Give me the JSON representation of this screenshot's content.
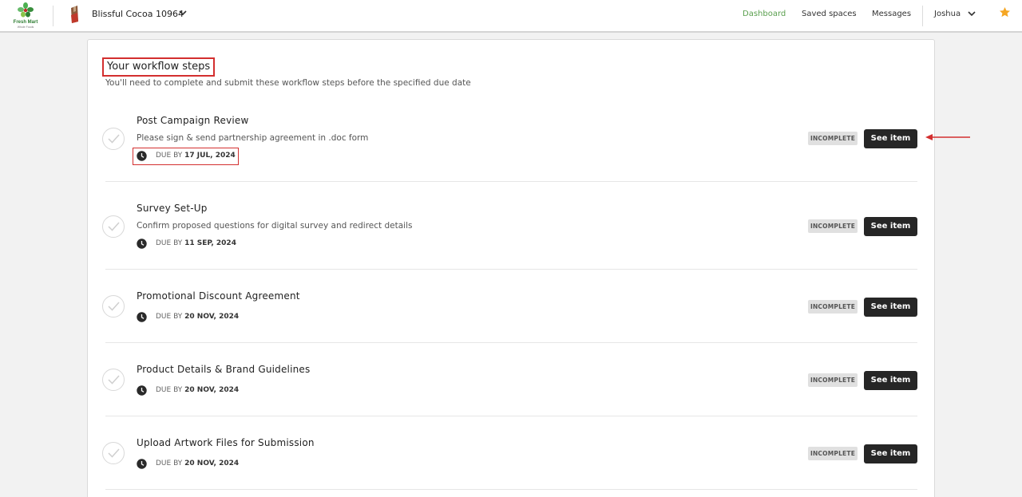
{
  "header": {
    "logo": {
      "name": "Fresh Mart",
      "tagline": "Whole Foods"
    },
    "brand": {
      "name": "Blissful Cocoa 10964"
    },
    "nav": [
      {
        "label": "Dashboard",
        "active": true
      },
      {
        "label": "Saved spaces",
        "active": false
      },
      {
        "label": "Messages",
        "active": false
      }
    ],
    "user": {
      "name": "Joshua"
    },
    "icons": [
      "leaf-logo-icon",
      "chocolate-bar-icon",
      "chevron-down-icon",
      "star-icon"
    ]
  },
  "workflow": {
    "title": "Your workflow steps",
    "subtitle": "You'll need to complete and submit these workflow steps before the specified due date",
    "due_prefix": "DUE BY",
    "steps": [
      {
        "title": "Post Campaign Review",
        "description": "Please sign & send partnership agreement in .doc form",
        "due_date": "17 JUL, 2024",
        "status": "INCOMPLETE",
        "action": "See item"
      },
      {
        "title": "Survey Set-Up",
        "description": "Confirm proposed questions for digital survey and redirect details",
        "due_date": "11 SEP, 2024",
        "status": "INCOMPLETE",
        "action": "See item"
      },
      {
        "title": "Promotional Discount Agreement",
        "description": "",
        "due_date": "20 NOV, 2024",
        "status": "INCOMPLETE",
        "action": "See item"
      },
      {
        "title": "Product Details & Brand Guidelines",
        "description": "",
        "due_date": "20 NOV, 2024",
        "status": "INCOMPLETE",
        "action": "See item"
      },
      {
        "title": "Upload Artwork Files for Submission",
        "description": "",
        "due_date": "20 NOV, 2024",
        "status": "INCOMPLETE",
        "action": "See item"
      }
    ]
  },
  "colors": {
    "accent_green": "#5a9f4e",
    "highlight_red": "#d32f2f",
    "button_dark": "#262626",
    "star_orange": "#f5a623"
  }
}
